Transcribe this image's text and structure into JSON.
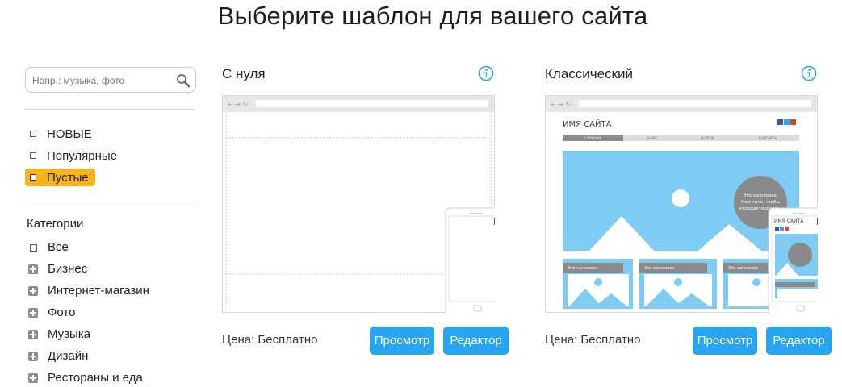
{
  "title": "Выберите шаблон для вашего сайта",
  "search": {
    "placeholder": "Напр.: музыка, фото"
  },
  "filters": [
    {
      "label": "НОВЫЕ",
      "active": false
    },
    {
      "label": "Популярные",
      "active": false
    },
    {
      "label": "Пустые",
      "active": true
    }
  ],
  "categories": {
    "heading": "Категории",
    "items": [
      {
        "label": "Все",
        "icon": "checkbox-icon"
      },
      {
        "label": "Бизнес",
        "icon": "plus-icon"
      },
      {
        "label": "Интернет-магазин",
        "icon": "plus-icon"
      },
      {
        "label": "Фото",
        "icon": "plus-icon"
      },
      {
        "label": "Музыка",
        "icon": "plus-icon"
      },
      {
        "label": "Дизайн",
        "icon": "plus-icon"
      },
      {
        "label": "Рестораны и еда",
        "icon": "plus-icon"
      }
    ]
  },
  "templates": [
    {
      "title": "С нуля",
      "price": "Цена: Бесплатно",
      "preview_label": "Просмотр",
      "editor_label": "Редактор"
    },
    {
      "title": "Классический",
      "price": "Цена: Бесплатно",
      "preview_label": "Просмотр",
      "editor_label": "Редактор",
      "mock": {
        "site_name": "ИМЯ САЙТА",
        "nav": [
          "ГЛАВНАЯ",
          "О НАС",
          "УСЛУГИ",
          "КОНТАКТЫ"
        ],
        "hero_text": [
          "Это заголовок.",
          "Нажмите, чтобы",
          "отредактировать."
        ],
        "block_title": "Это заголовок",
        "mobile_site_name": "ИМЯ САЙТА"
      }
    }
  ],
  "colors": {
    "accent": "#27a6ef",
    "active_filter": "#f8b21a",
    "hero_sky": "#7ecbf4"
  }
}
